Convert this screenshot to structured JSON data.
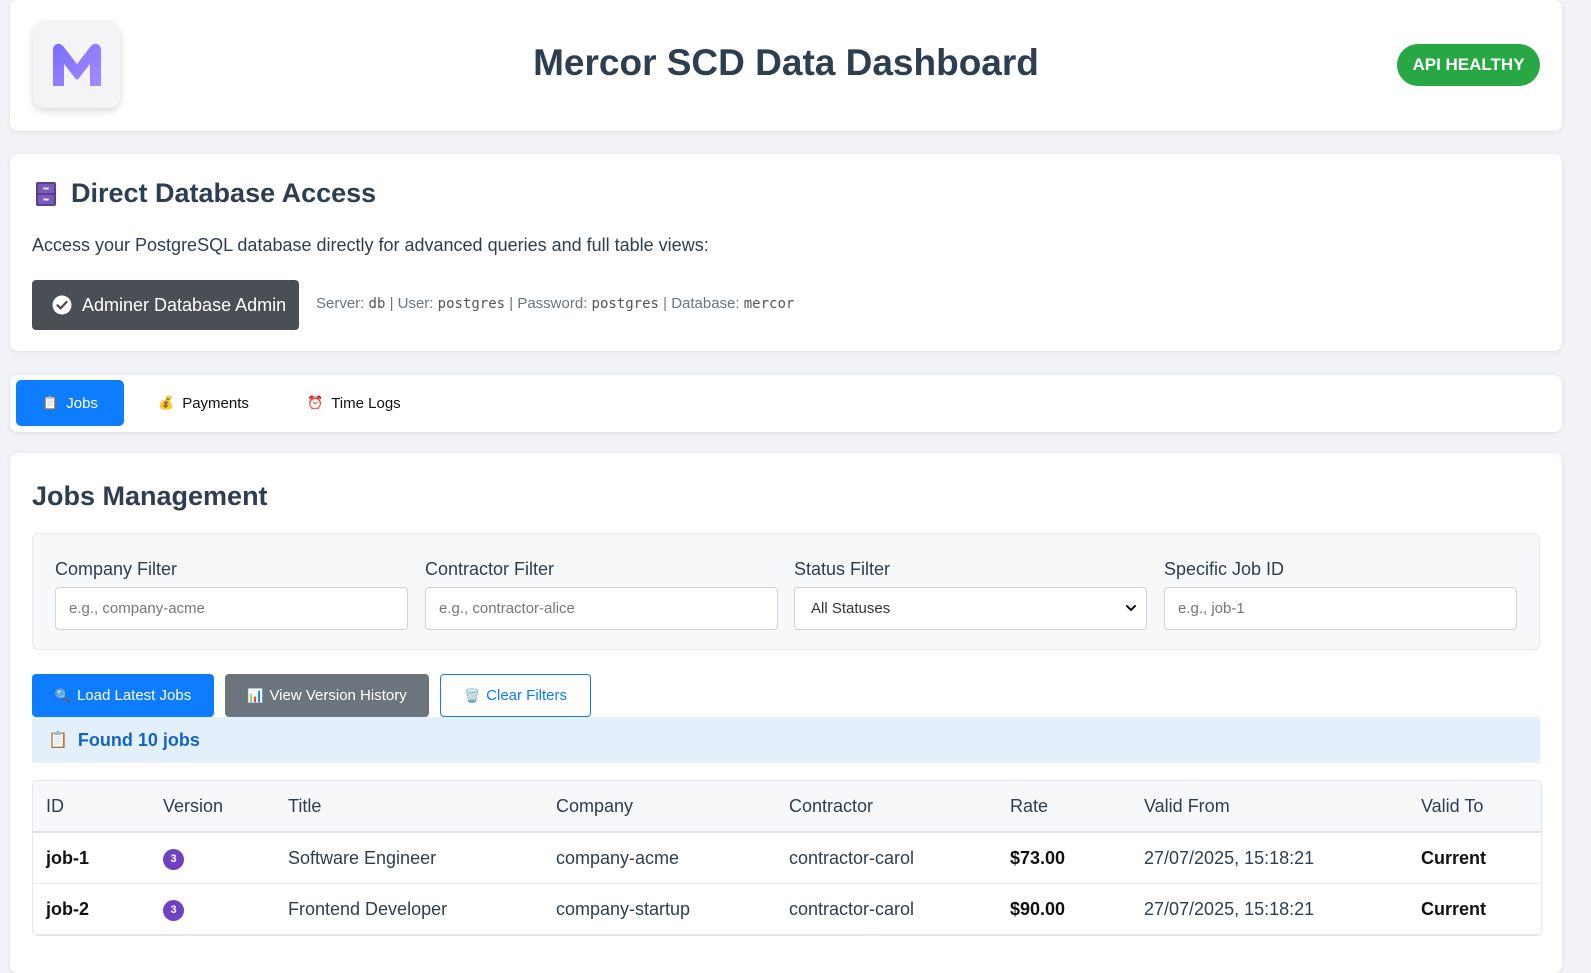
{
  "header": {
    "title": "Mercor SCD Data Dashboard",
    "api_status": "API HEALTHY",
    "logo_icon": "mercor-m-logo"
  },
  "db_access": {
    "icon": "file-cabinet-icon",
    "title": "Direct Database Access",
    "description": "Access your PostgreSQL database directly for advanced queries and full table views:",
    "button_label": "Adminer Database Admin",
    "creds": {
      "server_label": "Server:",
      "server": "db",
      "user_label": "| User:",
      "user": "postgres",
      "password_label": "| Password:",
      "password": "postgres",
      "database_label": "| Database:",
      "database": "mercor"
    }
  },
  "tabs": [
    {
      "label": "Jobs",
      "icon": "clipboard-icon",
      "emoji": "📋",
      "active": true
    },
    {
      "label": "Payments",
      "icon": "money-bag-icon",
      "emoji": "💰",
      "active": false
    },
    {
      "label": "Time Logs",
      "icon": "alarm-clock-icon",
      "emoji": "⏰",
      "active": false
    }
  ],
  "jobs": {
    "title": "Jobs Management",
    "filters": {
      "company": {
        "label": "Company Filter",
        "placeholder": "e.g., company-acme"
      },
      "contractor": {
        "label": "Contractor Filter",
        "placeholder": "e.g., contractor-alice"
      },
      "status": {
        "label": "Status Filter",
        "selected": "All Statuses"
      },
      "job_id": {
        "label": "Specific Job ID",
        "placeholder": "e.g., job-1"
      }
    },
    "actions": {
      "load": "Load Latest Jobs",
      "history": "View Version History",
      "clear": "Clear Filters"
    },
    "found_text": "Found 10 jobs",
    "table": {
      "columns": [
        "ID",
        "Version",
        "Title",
        "Company",
        "Contractor",
        "Rate",
        "Valid From",
        "Valid To"
      ],
      "rows": [
        {
          "id": "job-1",
          "version": "3",
          "title": "Software Engineer",
          "company": "company-acme",
          "contractor": "contractor-carol",
          "rate": "$73.00",
          "valid_from": "27/07/2025, 15:18:21",
          "valid_to": "Current"
        },
        {
          "id": "job-2",
          "version": "3",
          "title": "Frontend Developer",
          "company": "company-startup",
          "contractor": "contractor-carol",
          "rate": "$90.00",
          "valid_from": "27/07/2025, 15:18:21",
          "valid_to": "Current"
        }
      ]
    }
  },
  "colors": {
    "primary": "#0d7cff",
    "success": "#28a745",
    "dark_button": "#4a4e55",
    "secondary_button": "#6c757d",
    "version_badge": "#6f42c1",
    "info_bg": "#e3f0fc",
    "info_text": "#1565c0"
  }
}
